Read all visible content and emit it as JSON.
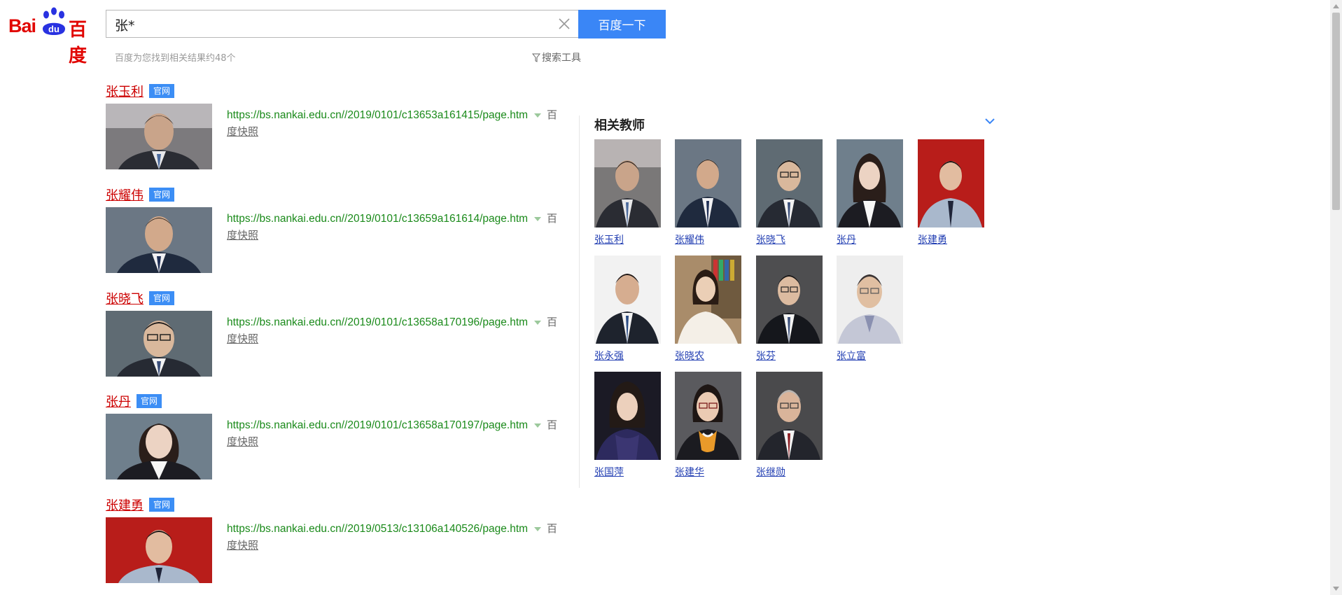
{
  "logo": {
    "part1": "Bai",
    "part2": "du",
    "part3": "百度"
  },
  "search": {
    "query": "张*",
    "button_label": "百度一下"
  },
  "result_count": "百度为您找到相关结果约48个",
  "search_tools": "搜索工具",
  "results": [
    {
      "title": "张玉利",
      "badge": "官网",
      "url": "https://bs.nankai.edu.cn//2019/0101/c13653a161415/page.htm",
      "baidu_start": "百",
      "snapshot": "度快照"
    },
    {
      "title": "张耀伟",
      "badge": "官网",
      "url": "https://bs.nankai.edu.cn//2019/0101/c13659a161614/page.htm",
      "baidu_start": "百",
      "snapshot": "度快照"
    },
    {
      "title": "张晓飞",
      "badge": "官网",
      "url": "https://bs.nankai.edu.cn//2019/0101/c13658a170196/page.htm",
      "baidu_start": "百",
      "snapshot": "度快照"
    },
    {
      "title": "张丹",
      "badge": "官网",
      "url": "https://bs.nankai.edu.cn//2019/0101/c13658a170197/page.htm",
      "baidu_start": "百",
      "snapshot": "度快照"
    },
    {
      "title": "张建勇",
      "badge": "官网",
      "url": "https://bs.nankai.edu.cn//2019/0513/c13106a140526/page.htm",
      "baidu_start": "百",
      "snapshot": "度快照"
    }
  ],
  "panel": {
    "title": "相关教师",
    "teachers": [
      {
        "name": "张玉利"
      },
      {
        "name": "张耀伟"
      },
      {
        "name": "张晓飞"
      },
      {
        "name": "张丹"
      },
      {
        "name": "张建勇"
      },
      {
        "name": "张永强"
      },
      {
        "name": "张晓农"
      },
      {
        "name": "张芬"
      },
      {
        "name": "张立富"
      },
      {
        "name": "张国萍"
      },
      {
        "name": "张建华"
      },
      {
        "name": "张继勋"
      }
    ]
  },
  "colors": {
    "accent": "#3a86f6",
    "title_red": "#c00000",
    "url_green": "#1a8a1a",
    "link_blue": "#2440b3",
    "badge_blue": "#3c8ef5"
  }
}
